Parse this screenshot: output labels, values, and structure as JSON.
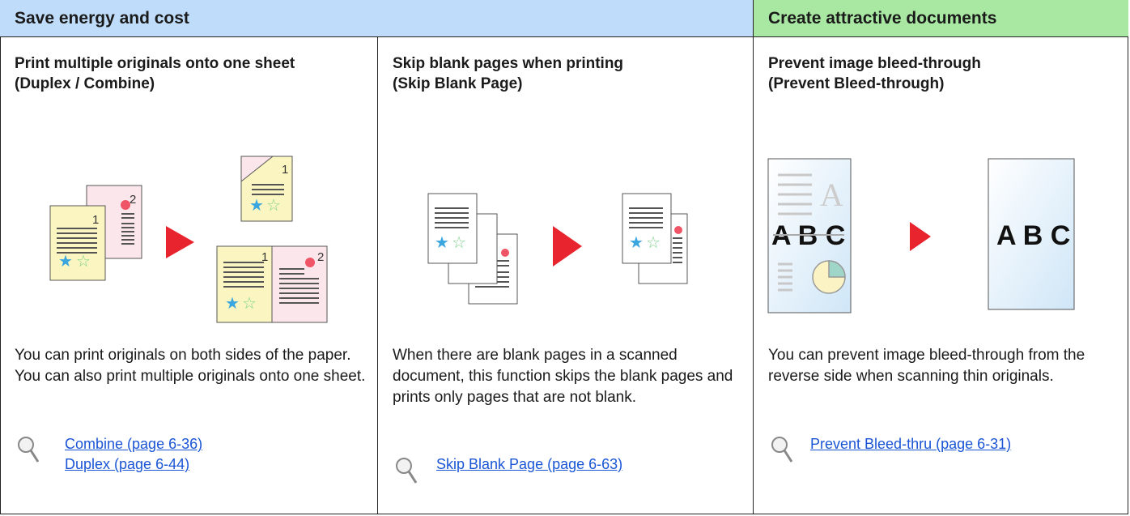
{
  "headers": {
    "left": "Save energy and cost",
    "right": "Create attractive documents"
  },
  "columns": [
    {
      "title_line1": "Print multiple originals onto one sheet",
      "title_line2": "(Duplex / Combine)",
      "description": "You can print originals on both sides of the paper. You can also print multiple originals onto one sheet.",
      "links": [
        "Combine (page 6-36)",
        "Duplex (page 6-44)"
      ]
    },
    {
      "title_line1": "Skip blank pages when printing",
      "title_line2": "(Skip Blank Page)",
      "description": "When there are blank pages in a scanned document, this function skips the blank pages and prints only pages that are not blank.",
      "links": [
        "Skip Blank Page (page 6-63)"
      ]
    },
    {
      "title_line1": "Prevent image bleed-through",
      "title_line2": "(Prevent Bleed-through)",
      "description": "You can prevent image bleed-through from the reverse side when scanning thin originals.",
      "links": [
        "Prevent Bleed-thru (page 6-31)"
      ]
    }
  ],
  "illustrations": {
    "page_numbers": [
      "1",
      "2"
    ],
    "sample_text": "A B C",
    "bleed_letter": "A"
  },
  "colors": {
    "header_blue": "#bfddfb",
    "header_green": "#a9e8a2",
    "paper_yellow": "#fbf6c1",
    "paper_pink": "#fbe6ec",
    "arrow_red": "#e8242e",
    "star_blue": "#3aa6e0",
    "star_green": "#7fd18c",
    "link_blue": "#1a55d6"
  },
  "icons": [
    "magnifier-icon",
    "arrow-right-icon",
    "star-icon",
    "pie-chart-icon"
  ]
}
